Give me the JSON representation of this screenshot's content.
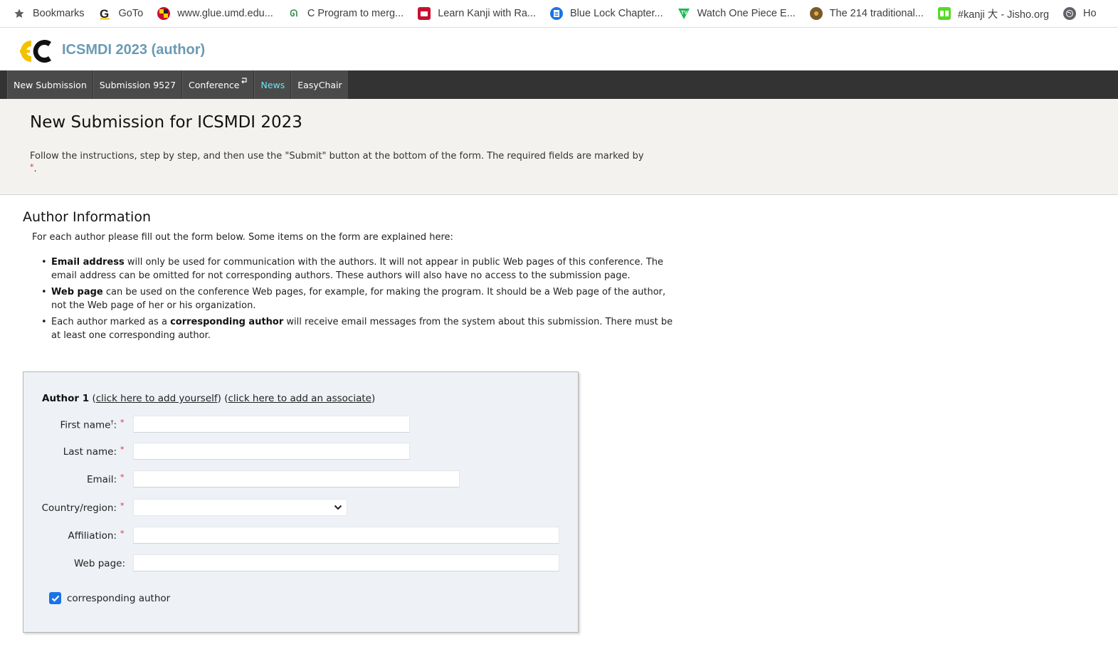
{
  "bookmarks": [
    {
      "label": "Bookmarks",
      "icon": "star-icon"
    },
    {
      "label": "GoTo",
      "icon": "goto-icon"
    },
    {
      "label": "www.glue.umd.edu...",
      "icon": "umd-icon"
    },
    {
      "label": "C Program to merg...",
      "icon": "gfg-icon"
    },
    {
      "label": "Learn Kanji with Ra...",
      "icon": "kanji-icon"
    },
    {
      "label": "Blue Lock Chapter...",
      "icon": "document-icon"
    },
    {
      "label": "Watch One Piece E...",
      "icon": "tv-icon"
    },
    {
      "label": "The 214 traditional...",
      "icon": "traditional-icon"
    },
    {
      "label": "#kanji 大 - Jisho.org",
      "icon": "jisho-icon"
    },
    {
      "label": "Ho",
      "icon": "globe-icon"
    }
  ],
  "header": {
    "title": "ICSMDI 2023 (author)"
  },
  "nav": [
    {
      "label": "New Submission",
      "active": false
    },
    {
      "label": "Submission 9527",
      "active": false
    },
    {
      "label": "Conference",
      "active": false
    },
    {
      "label": "News",
      "active": true
    },
    {
      "label": "EasyChair",
      "active": false
    }
  ],
  "intro": {
    "heading": "New Submission for ICSMDI 2023",
    "instructions": "Follow the instructions, step by step, and then use the \"Submit\" button at the bottom of the form. The required fields are marked by",
    "required_marker": "*",
    "period": "."
  },
  "author_info": {
    "title": "Author Information",
    "description": "For each author please fill out the form below. Some items on the form are explained here:",
    "items": [
      {
        "bold": "Email address",
        "text": " will only be used for communication with the authors. It will not appear in public Web pages of this conference. The email address can be omitted for not corresponding authors. These authors will also have no access to the submission page."
      },
      {
        "bold": "Web page",
        "text": " can be used on the conference Web pages, for example, for making the program. It should be a Web page of the author, not the Web page of her or his organization."
      },
      {
        "pre": "Each author marked as a ",
        "bold": "corresponding author",
        "text": " will receive email messages from the system about this submission. There must be at least one corresponding author."
      }
    ]
  },
  "form": {
    "author_label": "Author 1",
    "add_yourself": "click here to add yourself",
    "add_associate": "click here to add an associate",
    "fields": {
      "first_name": {
        "label": "First name",
        "dagger": "†",
        "suffix": ":",
        "value": ""
      },
      "last_name": {
        "label": "Last name:",
        "value": ""
      },
      "email": {
        "label": "Email:",
        "value": ""
      },
      "country": {
        "label": "Country/region:",
        "value": ""
      },
      "affiliation": {
        "label": "Affiliation:",
        "value": ""
      },
      "web_page": {
        "label": "Web page:",
        "value": ""
      }
    },
    "required_marker": "*",
    "corresponding_label": "corresponding author",
    "corresponding_checked": true
  },
  "colors": {
    "accent": "#6a9bb4",
    "nav_bg": "#333333",
    "active_nav": "#6fe3f0",
    "checkbox": "#1a73e8",
    "required": "#dd3333"
  }
}
